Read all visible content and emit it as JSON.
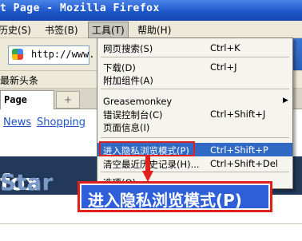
{
  "window": {
    "title": "t Page - Mozilla Firefox"
  },
  "menubar": {
    "history": "历史(S)",
    "bookmarks": "书签(B)",
    "tools": "工具(T)",
    "help": "帮助(H)"
  },
  "navbar": {
    "url": "http://www."
  },
  "bookmarks_bar": {
    "item": "最新头条"
  },
  "tabs": {
    "active": "Page",
    "new_tab": "+"
  },
  "links": {
    "news": "News",
    "shopping": "Shopping"
  },
  "banner": {
    "text_a": "fox",
    "text_b": "Star"
  },
  "tools_menu": {
    "items": [
      {
        "label": "网页搜索(S)",
        "shortcut": "Ctrl+K"
      },
      {
        "label": "下载(D)",
        "shortcut": "Ctrl+J"
      },
      {
        "label": "附加组件(A)",
        "shortcut": ""
      },
      {
        "label": "Greasemonkey",
        "shortcut": ""
      },
      {
        "label": "错误控制台(C)",
        "shortcut": "Ctrl+Shift+J"
      },
      {
        "label": "页面信息(I)",
        "shortcut": ""
      },
      {
        "label": "进入隐私浏览模式(P)",
        "shortcut": "Ctrl+Shift+P"
      },
      {
        "label": "清空最近历史记录(H)...",
        "shortcut": "Ctrl+Shift+Del"
      },
      {
        "label": "选项(O)...",
        "shortcut": ""
      }
    ]
  },
  "callout": {
    "text": "进入隐私浏览模式(P)"
  },
  "colors": {
    "highlight": "#316ac5",
    "annotation": "#e0201c",
    "callout_bg": "#2e5fd8"
  }
}
